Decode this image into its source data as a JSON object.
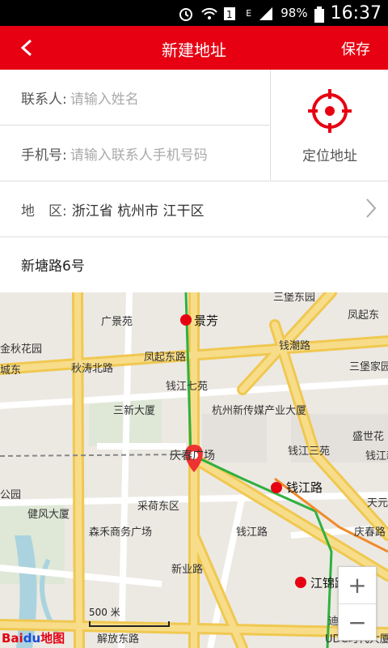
{
  "status": {
    "battery": "98%",
    "time": "16:37",
    "network": "E"
  },
  "header": {
    "title": "新建地址",
    "save": "保存"
  },
  "form": {
    "contact_label": "联系人:",
    "contact_placeholder": "请输入姓名",
    "phone_label": "手机号:",
    "phone_placeholder": "请输入联系人手机号码",
    "locate_label": "定位地址",
    "area_label": "地　区:",
    "area_value": "浙江省 杭州市 江干区",
    "address": "新塘路6号"
  },
  "map": {
    "pois": [
      "三堡东园",
      "凤起东",
      "广景苑",
      "景芳",
      "金秋花园",
      "城东",
      "凤起东路",
      "钱潮路",
      "三堡家园",
      "秋涛北路",
      "钱江七苑",
      "三新大厦",
      "杭州新传媒产业大厦",
      "盛世花",
      "钱江新",
      "庆春广场",
      "钱江三苑",
      "公园",
      "钱江路",
      "健风大厦",
      "采荷东区",
      "天元",
      "森禾商务广场",
      "钱江路",
      "庆春路",
      "新业路",
      "江锦路",
      "迪凯银座",
      "解放东路",
      "UDC时代大厦",
      "涛北路"
    ],
    "scale": "500 米",
    "logo_a": "Bai",
    "logo_b": "du",
    "logo_c": "地图"
  },
  "colors": {
    "brand": "#e60012",
    "road_major": "#f5d36a",
    "metro_green": "#2fb040",
    "metro_orange": "#f08a2a"
  }
}
